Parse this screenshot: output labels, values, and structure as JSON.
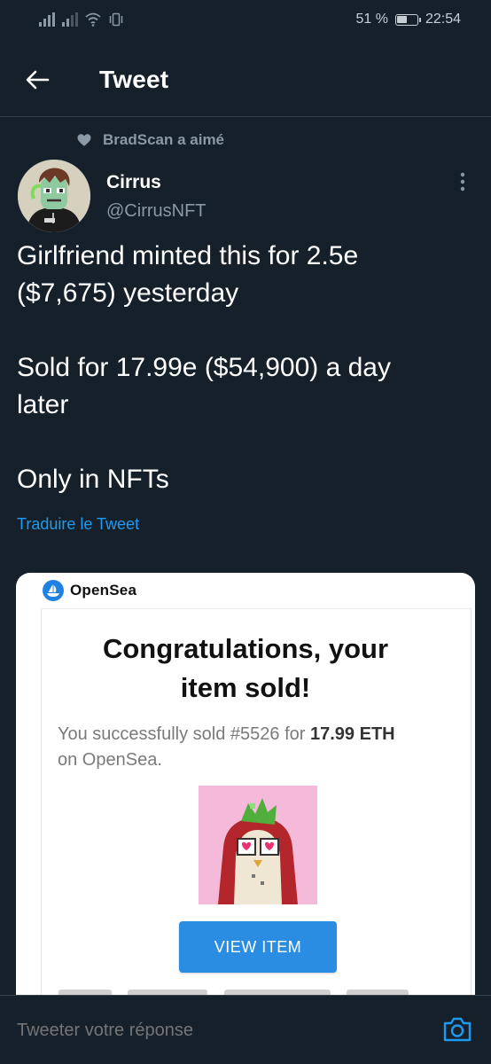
{
  "status_bar": {
    "battery_percent": "51 %",
    "time": "22:54"
  },
  "header": {
    "title": "Tweet"
  },
  "social_context": {
    "text": "BradScan a aimé"
  },
  "author": {
    "name": "Cirrus",
    "handle": "@CirrusNFT"
  },
  "tweet": {
    "lines": [
      "Girlfriend minted this for 2.5e",
      "($7,675) yesterday",
      "Sold for 17.99e ($54,900) a day",
      "later",
      "Only in NFTs"
    ],
    "translate_label": "Traduire le Tweet"
  },
  "media": {
    "brand": "OpenSea",
    "heading_line1": "Congratulations, your",
    "heading_line2": "item sold!",
    "message_prefix": "You successfully sold #5526 for ",
    "message_amount": "17.99 ETH",
    "message_suffix": "on OpenSea.",
    "button_label": "VIEW ITEM"
  },
  "reply": {
    "placeholder": "Tweeter votre réponse"
  },
  "colors": {
    "background": "#15202b",
    "accent": "#1d9bf0",
    "secondary_text": "#8b98a5",
    "opensea_button": "#2a8de2",
    "nft_background": "#f5b9da"
  }
}
